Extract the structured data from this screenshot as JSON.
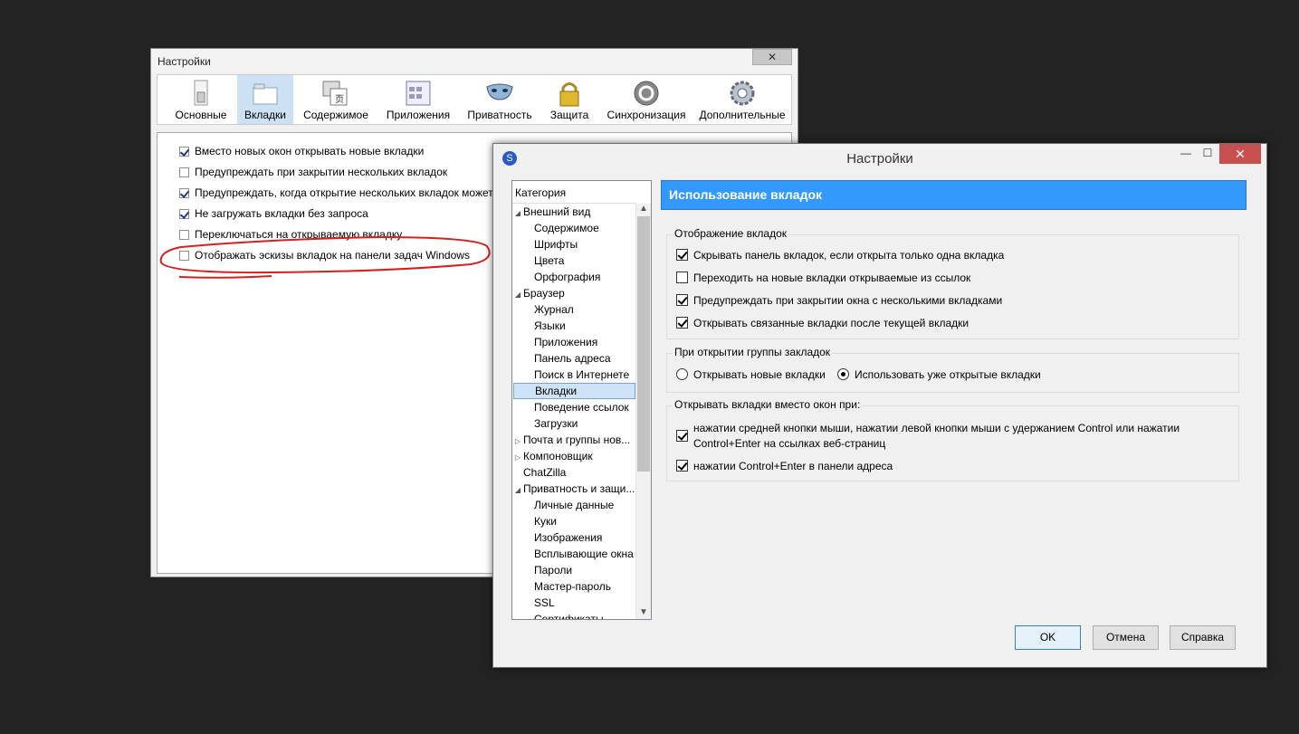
{
  "back_window": {
    "title": "Настройки",
    "close_label": "✕",
    "toolbar": [
      {
        "label": "Основные",
        "icon": "switch-icon"
      },
      {
        "label": "Вкладки",
        "icon": "tabs-icon",
        "selected": true
      },
      {
        "label": "Содержимое",
        "icon": "content-icon"
      },
      {
        "label": "Приложения",
        "icon": "applications-icon"
      },
      {
        "label": "Приватность",
        "icon": "mask-icon"
      },
      {
        "label": "Защита",
        "icon": "lock-icon"
      },
      {
        "label": "Синхронизация",
        "icon": "sync-icon"
      },
      {
        "label": "Дополнительные",
        "icon": "gear-icon"
      }
    ],
    "options": [
      {
        "label": "Вместо новых окон открывать новые вкладки",
        "checked": true
      },
      {
        "label": "Предупреждать при закрытии нескольких вкладок",
        "checked": false
      },
      {
        "label": "Предупреждать, когда открытие нескольких вкладок может",
        "checked": true
      },
      {
        "label": "Не загружать вкладки без запроса",
        "checked": true
      },
      {
        "label": "Переключаться на открываемую вкладку",
        "checked": false
      },
      {
        "label": "Отображать эскизы вкладок на панели задач Windows",
        "checked": false
      }
    ]
  },
  "front_window": {
    "title": "Настройки",
    "app_icon": "seamonkey-icon",
    "min_label": "—",
    "max_label": "☐",
    "close_label": "✕",
    "category_header": "Категория",
    "categories": [
      {
        "label": "Внешний вид",
        "level": 0,
        "expander": "◢"
      },
      {
        "label": "Содержимое",
        "level": 1
      },
      {
        "label": "Шрифты",
        "level": 1
      },
      {
        "label": "Цвета",
        "level": 1
      },
      {
        "label": "Орфография",
        "level": 1
      },
      {
        "label": "Браузер",
        "level": 0,
        "expander": "◢"
      },
      {
        "label": "Журнал",
        "level": 1
      },
      {
        "label": "Языки",
        "level": 1
      },
      {
        "label": "Приложения",
        "level": 1
      },
      {
        "label": "Панель адреса",
        "level": 1
      },
      {
        "label": "Поиск в Интернете",
        "level": 1
      },
      {
        "label": "Вкладки",
        "level": 1,
        "selected": true
      },
      {
        "label": "Поведение ссылок",
        "level": 1
      },
      {
        "label": "Загрузки",
        "level": 1
      },
      {
        "label": "Почта и группы нов...",
        "level": 0,
        "expander": "▷"
      },
      {
        "label": "Компоновщик",
        "level": 0,
        "expander": "▷"
      },
      {
        "label": "ChatZilla",
        "level": 0
      },
      {
        "label": "Приватность и защи...",
        "level": 0,
        "expander": "◢"
      },
      {
        "label": "Личные данные",
        "level": 1
      },
      {
        "label": "Куки",
        "level": 1
      },
      {
        "label": "Изображения",
        "level": 1
      },
      {
        "label": "Всплывающие окна",
        "level": 1
      },
      {
        "label": "Пароли",
        "level": 1
      },
      {
        "label": "Мастер-пароль",
        "level": 1
      },
      {
        "label": "SSL",
        "level": 1
      },
      {
        "label": "Сертификаты",
        "level": 1
      }
    ],
    "panel_title": "Использование вкладок",
    "group1": {
      "title": "Отображение вкладок",
      "items": [
        {
          "label": "Скрывать панель вкладок, если открыта только одна вкладка",
          "checked": true
        },
        {
          "label": "Переходить на новые вкладки открываемые из ссылок",
          "checked": false
        },
        {
          "label": "Предупреждать при закрытии окна с несколькими вкладками",
          "checked": true
        },
        {
          "label": "Открывать связанные вкладки после текущей вкладки",
          "checked": true
        }
      ]
    },
    "group2": {
      "title": "При открытии группы закладок",
      "radios": [
        {
          "label": "Открывать новые вкладки",
          "selected": false
        },
        {
          "label": "Использовать уже открытые вкладки",
          "selected": true
        }
      ]
    },
    "group3": {
      "title": "Открывать вкладки вместо окон при:",
      "items": [
        {
          "line1": "нажатии средней кнопки мыши, нажатии левой кнопки мыши с удержанием Control или нажатии",
          "line2": "Control+Enter на ссылках веб-страниц",
          "checked": true
        },
        {
          "line1": "нажатии Control+Enter в панели адреса",
          "checked": true
        }
      ]
    },
    "buttons": {
      "ok": "OK",
      "cancel": "Отмена",
      "help": "Справка"
    }
  }
}
